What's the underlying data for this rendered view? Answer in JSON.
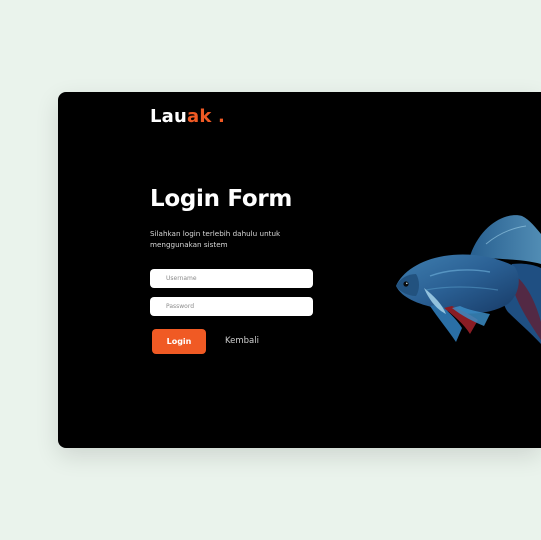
{
  "brand": {
    "name_main": "Lau",
    "name_accent": "ak",
    "dot": "."
  },
  "form": {
    "title": "Login Form",
    "subtitle": "Silahkan login terlebih dahulu untuk menggunakan sistem",
    "username_placeholder": "Username",
    "password_placeholder": "Password",
    "login_label": "Login",
    "back_label": "Kembali"
  },
  "image": {
    "icon": "betta-fish-image"
  },
  "colors": {
    "page_background": "#eaf3ec",
    "card_background": "#000000",
    "accent": "#f05a24",
    "text": "#ffffff"
  }
}
